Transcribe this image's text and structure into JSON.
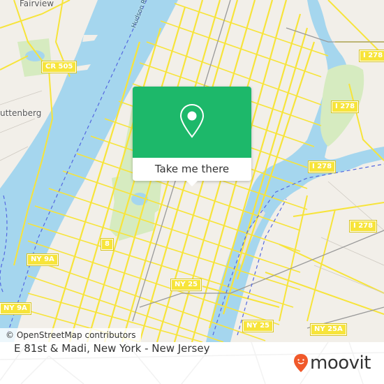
{
  "map": {
    "attribution": "© OpenStreetMap contributors",
    "places": [
      {
        "name": "Fairview"
      },
      {
        "name": "uttenberg"
      }
    ],
    "river_label": "Hudson Ri",
    "shields": [
      {
        "label": "CR 505"
      },
      {
        "label": "I 278"
      },
      {
        "label": "I 278"
      },
      {
        "label": "I 278"
      },
      {
        "label": "I 278"
      },
      {
        "label": "8"
      },
      {
        "label": "NY 9A"
      },
      {
        "label": "NY 9A"
      },
      {
        "label": "NY 25"
      },
      {
        "label": "NY 25"
      },
      {
        "label": "NY 25A"
      }
    ],
    "colors": {
      "water": "#a5d6ee",
      "land": "#f2efe9",
      "park": "#d6ebc0",
      "road": "#f7e43a",
      "ferry": "#5468e0"
    }
  },
  "popup": {
    "icon": "map-pin-icon",
    "button_label": "Take me there",
    "accent": "#1db86a"
  },
  "footer": {
    "location": "E 81st & Madi, New York - New Jersey",
    "brand": "moovit",
    "brand_color": "#f0592a"
  }
}
